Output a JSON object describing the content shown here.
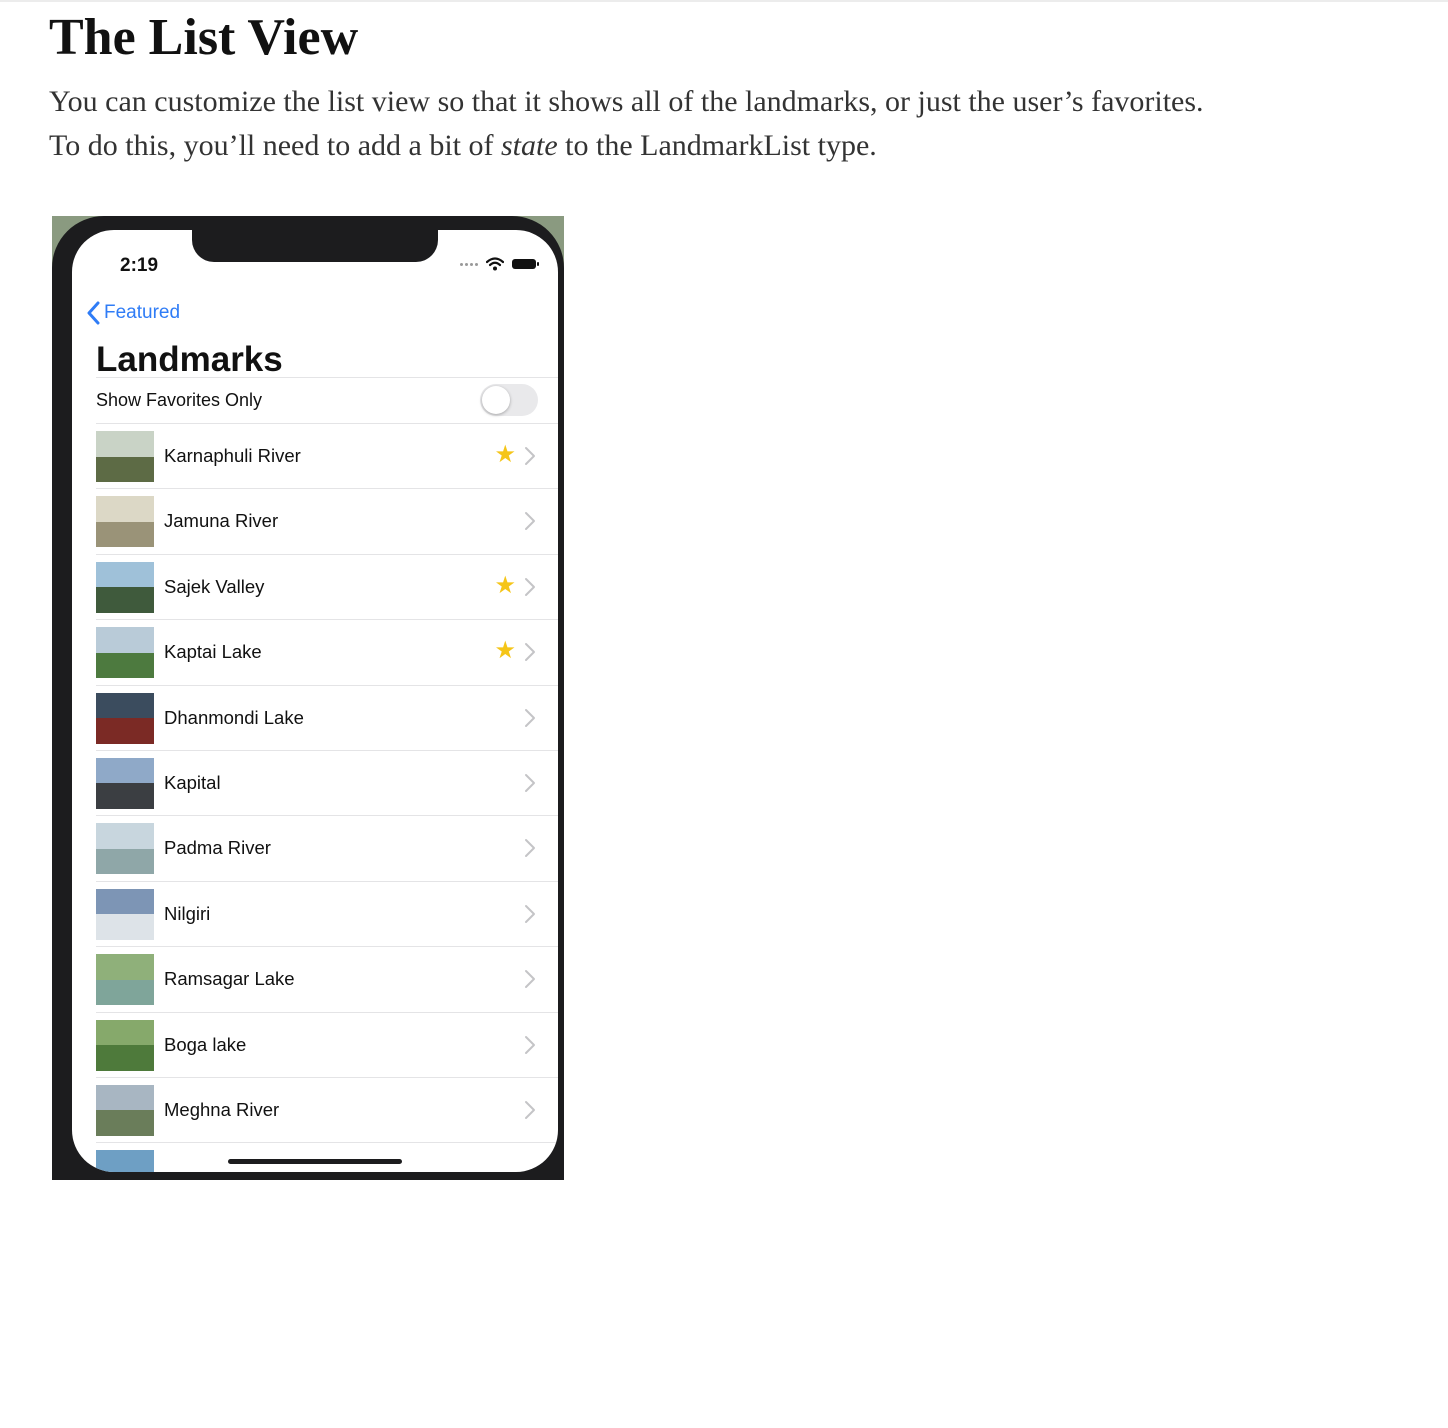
{
  "article": {
    "heading": "The List View",
    "para_line1": "You can customize the list view so that it shows all of the landmarks, or just the user’s favorites.",
    "para_line2_before": "To do this, you’ll need to add a bit of ",
    "para_line2_em": "state",
    "para_line2_after": " to the LandmarkList type."
  },
  "phone": {
    "time": "2:19",
    "back_label": "Featured",
    "title": "Landmarks",
    "toggle_label": "Show Favorites Only",
    "toggle_on": false,
    "rows": [
      {
        "name": "Karnaphuli River",
        "favorite": true,
        "sky": "#c9d3c6",
        "ground": "#5d6b45"
      },
      {
        "name": "Jamuna River",
        "favorite": false,
        "sky": "#dcd8c6",
        "ground": "#9a9378"
      },
      {
        "name": "Sajek Valley",
        "favorite": true,
        "sky": "#9fc1d9",
        "ground": "#3f5a3c"
      },
      {
        "name": "Kaptai Lake",
        "favorite": true,
        "sky": "#b9cbd8",
        "ground": "#4d7a3f"
      },
      {
        "name": "Dhanmondi Lake",
        "favorite": false,
        "sky": "#3b4c5e",
        "ground": "#7b2a25"
      },
      {
        "name": "Kapital",
        "favorite": false,
        "sky": "#8fa9c8",
        "ground": "#3b3e42"
      },
      {
        "name": "Padma River",
        "favorite": false,
        "sky": "#c8d6de",
        "ground": "#8fa7a8"
      },
      {
        "name": "Nilgiri",
        "favorite": false,
        "sky": "#7d95b5",
        "ground": "#dde3e8"
      },
      {
        "name": "Ramsagar Lake",
        "favorite": false,
        "sky": "#8fb07a",
        "ground": "#7fa59a"
      },
      {
        "name": "Boga lake",
        "favorite": false,
        "sky": "#86a96b",
        "ground": "#4e7a3b"
      },
      {
        "name": "Meghna River",
        "favorite": false,
        "sky": "#a8b6c2",
        "ground": "#6a7d5a"
      },
      {
        "name": "",
        "favorite": false,
        "sky": "#6e9fc4",
        "ground": "#3f6a3a"
      }
    ],
    "colors": {
      "accent": "#2f7cf6",
      "star": "#f5c518"
    }
  }
}
